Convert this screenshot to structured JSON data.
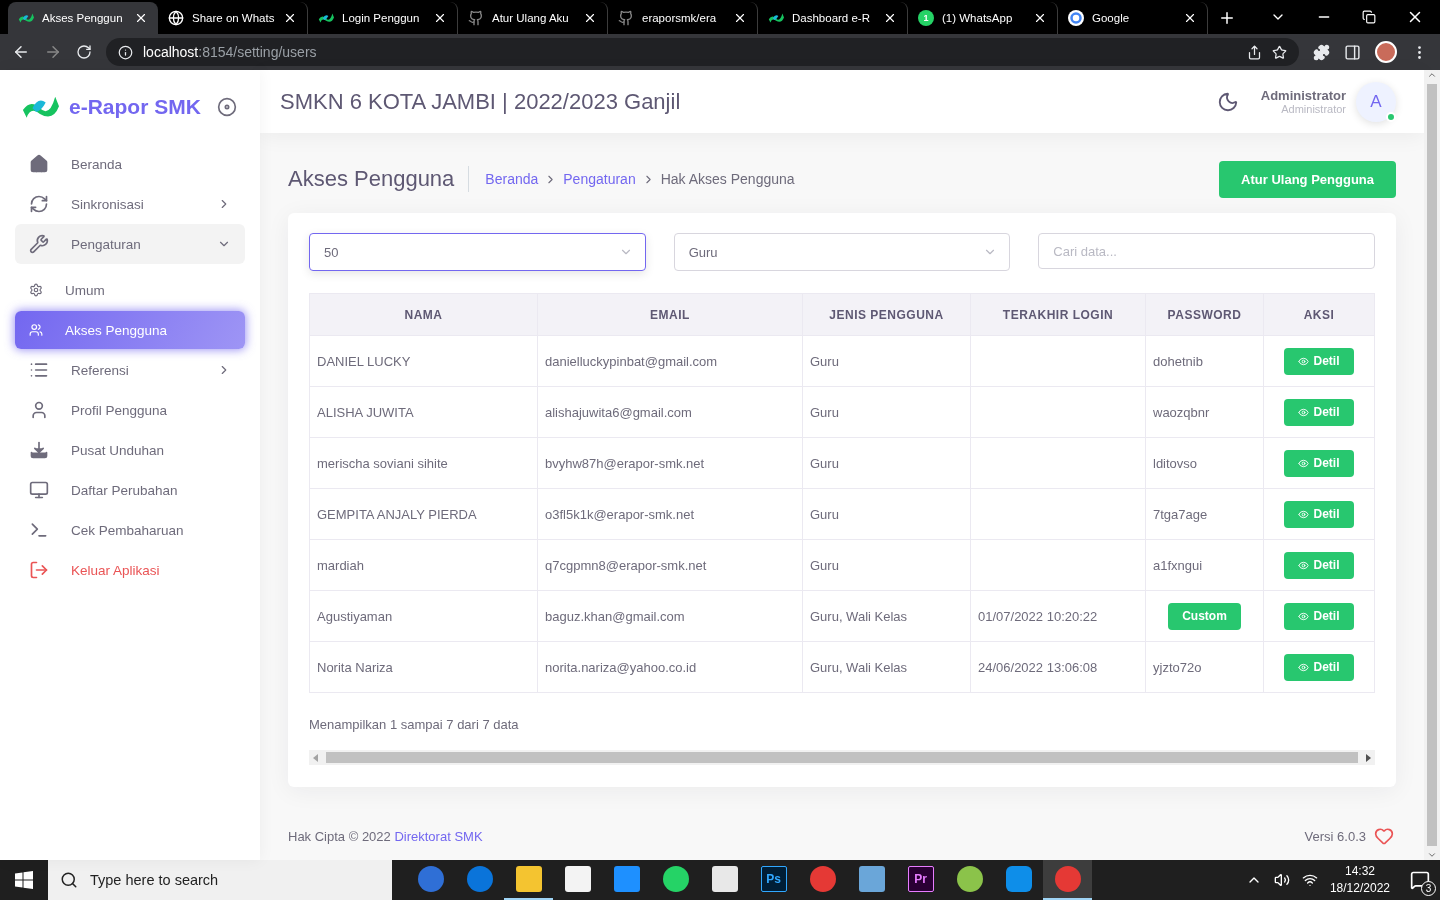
{
  "browser": {
    "tabs": [
      {
        "title": "Akses Penggun",
        "selected": true
      },
      {
        "title": "Share on Whats",
        "selected": false
      },
      {
        "title": "Login Penggun",
        "selected": false
      },
      {
        "title": "Atur Ulang Aku",
        "selected": false
      },
      {
        "title": "eraporsmk/era",
        "selected": false
      },
      {
        "title": "Dashboard e-R",
        "selected": false
      },
      {
        "title": "(1) WhatsApp",
        "selected": false,
        "badge": "1"
      },
      {
        "title": "Google",
        "selected": false
      }
    ],
    "address": {
      "host": "localhost",
      "path": ":8154/setting/users"
    }
  },
  "sidebar": {
    "brand": "e-Rapor SMK",
    "items": [
      {
        "label": "Beranda",
        "kind": "link",
        "has_children": false,
        "expanded": false,
        "selected": false
      },
      {
        "label": "Sinkronisasi",
        "kind": "link",
        "has_children": true,
        "expanded": false,
        "selected": false
      },
      {
        "label": "Pengaturan",
        "kind": "link",
        "has_children": true,
        "expanded": true,
        "selected": false,
        "children": [
          {
            "label": "Umum",
            "selected": false
          },
          {
            "label": "Akses Pengguna",
            "selected": true
          }
        ]
      },
      {
        "label": "Referensi",
        "kind": "link",
        "has_children": true,
        "expanded": false,
        "selected": false
      },
      {
        "label": "Profil Pengguna",
        "kind": "link",
        "has_children": false,
        "expanded": false,
        "selected": false
      },
      {
        "label": "Pusat Unduhan",
        "kind": "link",
        "has_children": false,
        "expanded": false,
        "selected": false
      },
      {
        "label": "Daftar Perubahan",
        "kind": "link",
        "has_children": false,
        "expanded": false,
        "selected": false
      },
      {
        "label": "Cek Pembaharuan",
        "kind": "link",
        "has_children": false,
        "expanded": false,
        "selected": false
      },
      {
        "label": "Keluar Aplikasi",
        "kind": "logout",
        "has_children": false,
        "expanded": false,
        "selected": false
      }
    ]
  },
  "header": {
    "title": "SMKN 6 KOTA JAMBI | 2022/2023 Ganjil",
    "user": {
      "name": "Administrator",
      "role": "Administrator",
      "initial": "A",
      "online": true
    }
  },
  "page": {
    "title": "Akses Pengguna",
    "breadcrumb": [
      {
        "label": "Beranda",
        "link": true
      },
      {
        "label": "Pengaturan",
        "link": true
      },
      {
        "label": "Hak Akses Pengguna",
        "link": false
      }
    ],
    "action": "Atur Ulang Pengguna"
  },
  "filters": {
    "per_page": "50",
    "role": "Guru",
    "search_placeholder": "Cari data..."
  },
  "table": {
    "columns": [
      "NAMA",
      "EMAIL",
      "JENIS PENGGUNA",
      "TERAKHIR LOGIN",
      "PASSWORD",
      "AKSI"
    ],
    "rows": [
      {
        "name": "DANIEL LUCKY",
        "email": "danielluckypinbat@gmail.com",
        "type": "Guru",
        "last_login": "",
        "password": {
          "kind": "text",
          "text": "dohetnib"
        },
        "action": "Detil"
      },
      {
        "name": "ALISHA JUWITA",
        "email": "alishajuwita6@gmail.com",
        "type": "Guru",
        "last_login": "",
        "password": {
          "kind": "text",
          "text": "waozqbnr"
        },
        "action": "Detil"
      },
      {
        "name": "merischa soviani sihite",
        "email": "bvyhw87h@erapor-smk.net",
        "type": "Guru",
        "last_login": "",
        "password": {
          "kind": "text",
          "text": "lditovso"
        },
        "action": "Detil"
      },
      {
        "name": "GEMPITA ANJALY PIERDA",
        "email": "o3fl5k1k@erapor-smk.net",
        "type": "Guru",
        "last_login": "",
        "password": {
          "kind": "text",
          "text": "7tga7age"
        },
        "action": "Detil"
      },
      {
        "name": "mardiah",
        "email": "q7cgpmn8@erapor-smk.net",
        "type": "Guru",
        "last_login": "",
        "password": {
          "kind": "text",
          "text": "a1fxngui"
        },
        "action": "Detil"
      },
      {
        "name": "Agustiyaman",
        "email": "baguz.khan@gmail.com",
        "type": "Guru, Wali Kelas",
        "last_login": "01/07/2022 10:20:22",
        "password": {
          "kind": "button",
          "text": "Custom"
        },
        "action": "Detil"
      },
      {
        "name": "Norita Nariza",
        "email": "norita.nariza@yahoo.co.id",
        "type": "Guru, Wali Kelas",
        "last_login": "24/06/2022 13:06:08",
        "password": {
          "kind": "text",
          "text": "yjzto72o"
        },
        "action": "Detil"
      }
    ],
    "summary": "Menampilkan 1 sampai 7 dari 7 data"
  },
  "footer": {
    "copyright": "Hak Cipta © 2022 ",
    "link": "Direktorat SMK",
    "version": "Versi 6.0.3"
  },
  "taskbar": {
    "search_placeholder": "Type here to search",
    "apps": [
      {
        "running": false,
        "selected": false
      },
      {
        "running": false,
        "selected": false
      },
      {
        "running": true,
        "selected": false
      },
      {
        "running": false,
        "selected": false
      },
      {
        "running": false,
        "selected": false
      },
      {
        "running": false,
        "selected": false
      },
      {
        "running": false,
        "selected": false
      },
      {
        "label": "Ps",
        "running": false,
        "selected": false
      },
      {
        "running": false,
        "selected": false
      },
      {
        "running": false,
        "selected": false
      },
      {
        "label": "Pr",
        "running": false,
        "selected": false
      },
      {
        "running": false,
        "selected": false
      },
      {
        "running": false,
        "selected": false
      },
      {
        "running": true,
        "selected": true
      }
    ],
    "time": "14:32",
    "date": "18/12/2022",
    "notifications": "3"
  }
}
